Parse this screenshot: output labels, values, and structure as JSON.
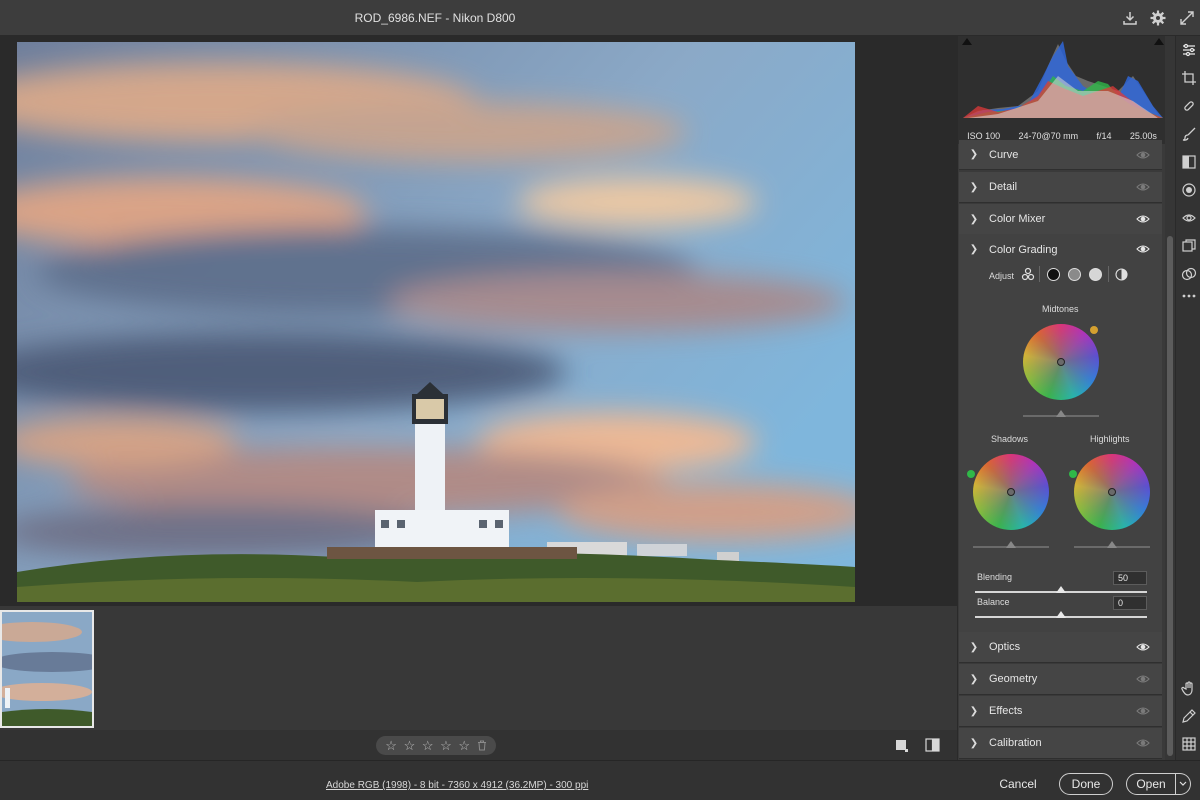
{
  "window": {
    "title": "ROD_6986.NEF  -  Nikon D800"
  },
  "histogram": {
    "iso": "ISO 100",
    "lens": "24-70@70 mm",
    "aperture": "f/14",
    "shutter": "25.00s"
  },
  "panels": {
    "curve": "Curve",
    "detail": "Detail",
    "color_mixer": "Color Mixer",
    "color_grading": "Color Grading",
    "optics": "Optics",
    "geometry": "Geometry",
    "effects": "Effects",
    "calibration": "Calibration"
  },
  "grading": {
    "adjust_label": "Adjust",
    "midtones_label": "Midtones",
    "shadows_label": "Shadows",
    "highlights_label": "Highlights",
    "blending_label": "Blending",
    "blending_value": "50",
    "blending_fraction": 0.5,
    "balance_label": "Balance",
    "balance_value": "0",
    "balance_fraction": 0.5
  },
  "footer": {
    "file_info": "Adobe RGB (1998) - 8 bit - 7360 x 4912 (36.2MP) - 300 ppi",
    "cancel": "Cancel",
    "done": "Done",
    "open": "Open"
  },
  "rating": {
    "stars": 0,
    "max": 5
  },
  "colors": {
    "accent": "#ffffff",
    "panel_bg": "#3a3a3a",
    "section_bg": "#454545"
  }
}
